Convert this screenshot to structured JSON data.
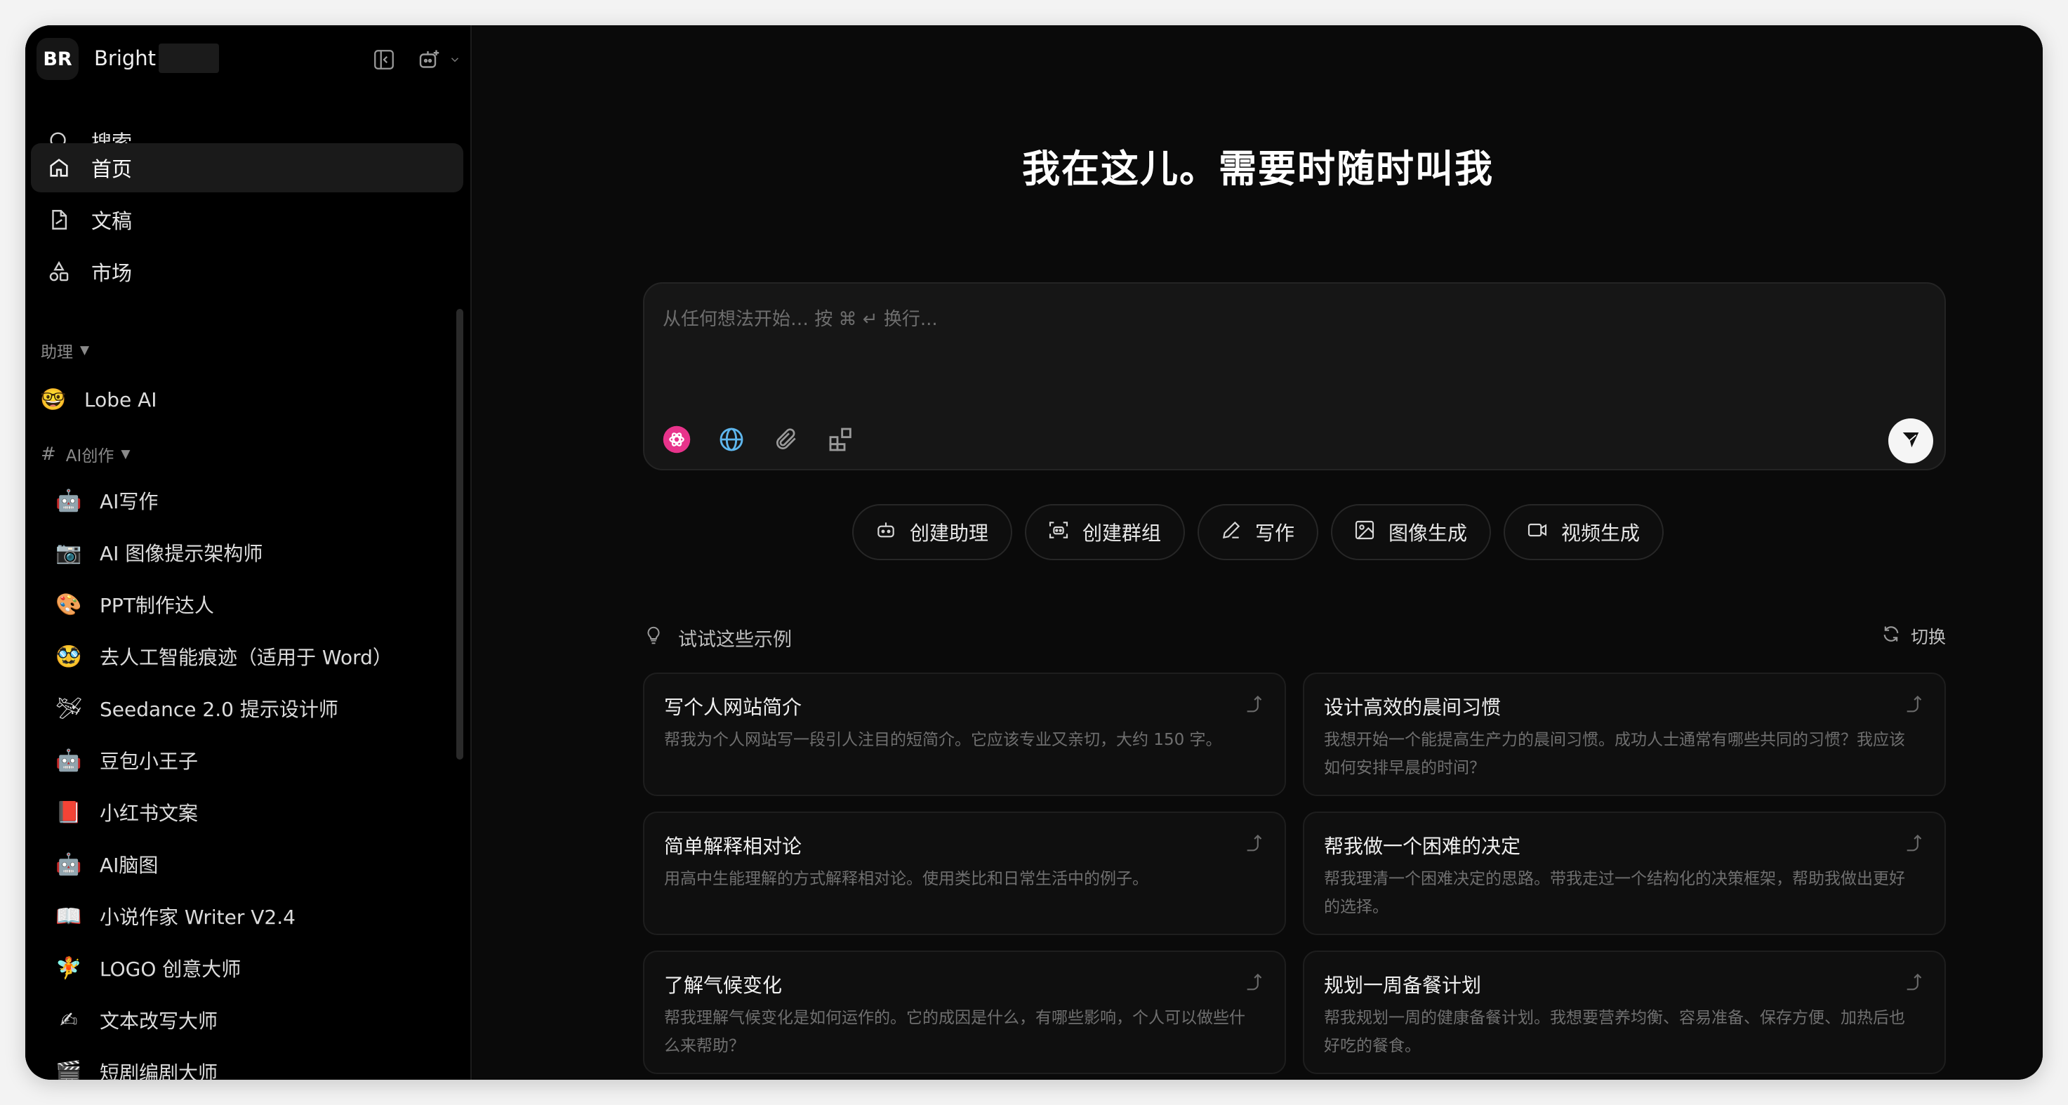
{
  "workspace": {
    "avatar": "BR",
    "name": "Bright"
  },
  "nav": [
    {
      "label": "搜索",
      "icon": "search-icon"
    },
    {
      "label": "首页",
      "icon": "home-icon",
      "active": true
    },
    {
      "label": "文稿",
      "icon": "document-icon"
    },
    {
      "label": "市场",
      "icon": "market-icon"
    }
  ],
  "sections": {
    "assistant": "助理",
    "ai_creation": "AI创作"
  },
  "lobe_ai": {
    "label": "Lobe AI",
    "emoji": "🤓"
  },
  "agents": [
    {
      "label": "AI写作",
      "emoji": "🤖"
    },
    {
      "label": "AI 图像提示架构师",
      "emoji": "📷"
    },
    {
      "label": "PPT制作达人",
      "emoji": "🎨"
    },
    {
      "label": "去人工智能痕迹（适用于 Word）",
      "emoji": "🥸"
    },
    {
      "label": "Seedance 2.0 提示设计师",
      "emoji": "🛩"
    },
    {
      "label": "豆包小王子",
      "emoji": "🤖"
    },
    {
      "label": "小红书文案",
      "emoji": "📕"
    },
    {
      "label": "AI脑图",
      "emoji": "🤖"
    },
    {
      "label": "小说作家 Writer V2.4",
      "emoji": "📖"
    },
    {
      "label": "LOGO 创意大师",
      "emoji": "🧚"
    },
    {
      "label": "文本改写大师",
      "emoji": "✍"
    },
    {
      "label": "短剧编剧大师",
      "emoji": "🎬"
    }
  ],
  "main": {
    "hero": "我在这儿。需要时随时叫我",
    "composer_placeholder": "从任何想法开始… 按 ⌘ ↵ 换行...",
    "actions": [
      {
        "label": "创建助理",
        "icon": "robot-icon"
      },
      {
        "label": "创建群组",
        "icon": "group-icon"
      },
      {
        "label": "写作",
        "icon": "pen-icon"
      },
      {
        "label": "图像生成",
        "icon": "image-icon"
      },
      {
        "label": "视频生成",
        "icon": "video-icon"
      }
    ],
    "examples_title": "试试这些示例",
    "switch_label": "切换",
    "examples": [
      {
        "title": "写个人网站简介",
        "desc": "帮我为个人网站写一段引人注目的短简介。它应该专业又亲切，大约 150 字。"
      },
      {
        "title": "设计高效的晨间习惯",
        "desc": "我想开始一个能提高生产力的晨间习惯。成功人士通常有哪些共同的习惯？我应该如何安排早晨的时间？"
      },
      {
        "title": "简单解释相对论",
        "desc": "用高中生能理解的方式解释相对论。使用类比和日常生活中的例子。"
      },
      {
        "title": "帮我做一个困难的决定",
        "desc": "帮我理清一个困难决定的思路。带我走过一个结构化的决策框架，帮助我做出更好的选择。"
      },
      {
        "title": "了解气候变化",
        "desc": "帮我理解气候变化是如何运作的。它的成因是什么，有哪些影响，个人可以做些什么来帮助？"
      },
      {
        "title": "规划一周备餐计划",
        "desc": "帮我规划一周的健康备餐计划。我想要营养均衡、容易准备、保存方便、加热后也好吃的餐食。"
      }
    ]
  }
}
